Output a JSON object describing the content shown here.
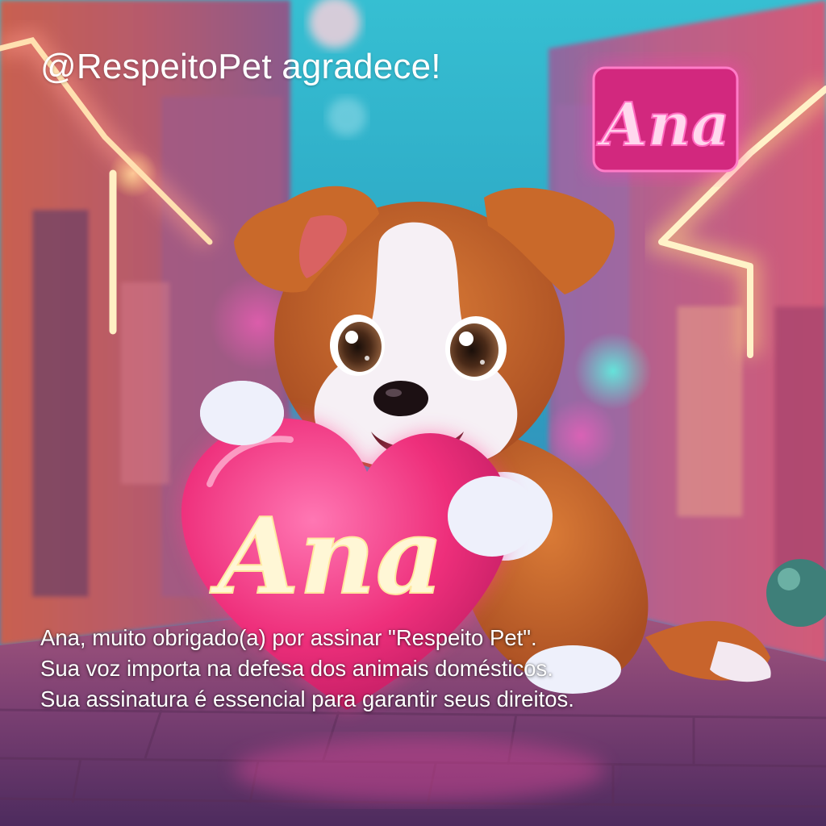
{
  "header": {
    "title": "@RespeitoPet agradece!"
  },
  "signs": {
    "neon_sign_text": "Ana",
    "heart_text": "Ana"
  },
  "message": {
    "lines": [
      "Ana, muito obrigado(a) por assinar \"Respeito Pet\".",
      "Sua voz importa na defesa dos animais domésticos.",
      "Sua assinatura é essencial para garantir seus direitos."
    ]
  },
  "colors": {
    "neon_pink": "#ff3fb0",
    "neon_warm": "#ffd27a",
    "sky_teal": "#2fb3c9",
    "heart_pink": "#f0327e",
    "puppy_fur": "#c9692a",
    "text": "#ffffff"
  }
}
